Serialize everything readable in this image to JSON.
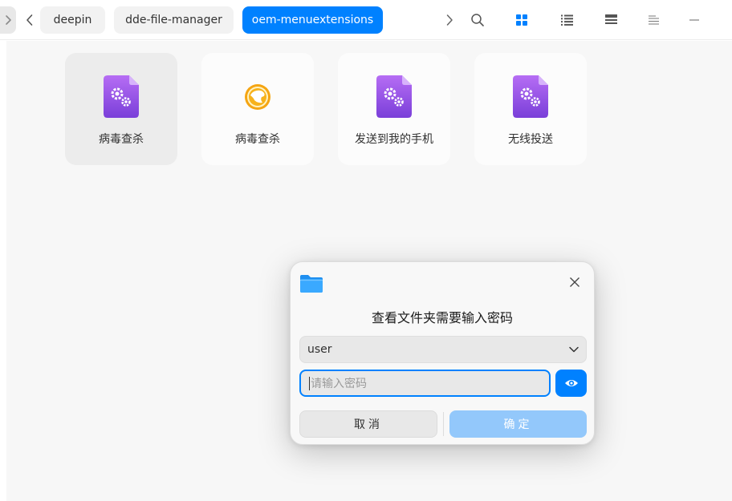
{
  "breadcrumbs": [
    "deepin",
    "dde-file-manager",
    "oem-menuextensions"
  ],
  "toolbar": {
    "search_icon": "search-icon",
    "view_icons": [
      "icon-view-icon",
      "list-view-icon",
      "tree-view-icon",
      "detail-panel-icon"
    ],
    "window_menu_icon": "menu-icon",
    "minimize_icon": "minimize-icon",
    "accent": "#0081ff"
  },
  "files": [
    {
      "label": "病毒查杀",
      "icon": "settings-file-icon",
      "selected": true
    },
    {
      "label": "病毒查杀",
      "icon": "antivirus-app-icon",
      "selected": false
    },
    {
      "label": "发送到我的手机",
      "icon": "settings-file-icon",
      "selected": false
    },
    {
      "label": "无线投送",
      "icon": "settings-file-icon",
      "selected": false
    }
  ],
  "dialog": {
    "title": "查看文件夹需要输入密码",
    "user_select": {
      "value": "user"
    },
    "password": {
      "placeholder": "请输入密码",
      "value": ""
    },
    "cancel_label": "取消",
    "ok_label": "确定"
  }
}
